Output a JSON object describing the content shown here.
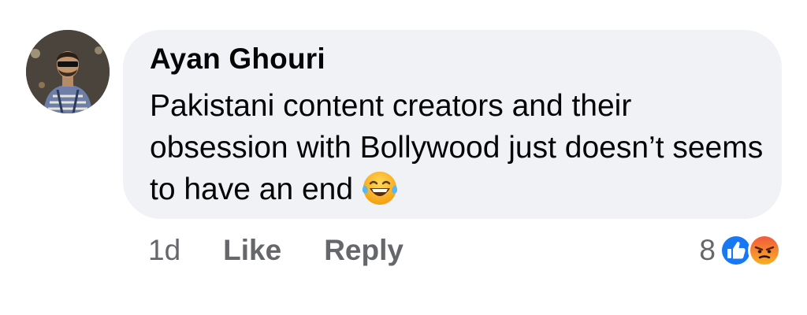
{
  "comment": {
    "author": "Ayan Ghouri",
    "text": "Pakistani content creators and their obsession with Bollywood just doesn’t seems to have an end",
    "emoji": "tears-of-joy-emoji",
    "timestamp": "1d",
    "like_label": "Like",
    "reply_label": "Reply",
    "reaction_count": "8",
    "reaction_icons": [
      "like-reaction-icon",
      "angry-reaction-icon"
    ]
  },
  "colors": {
    "bubble_bg": "#f0f2f5",
    "text": "#050505",
    "secondary": "#65676b",
    "like_blue": "#1877f2",
    "angry_red": "#f05a3b"
  }
}
